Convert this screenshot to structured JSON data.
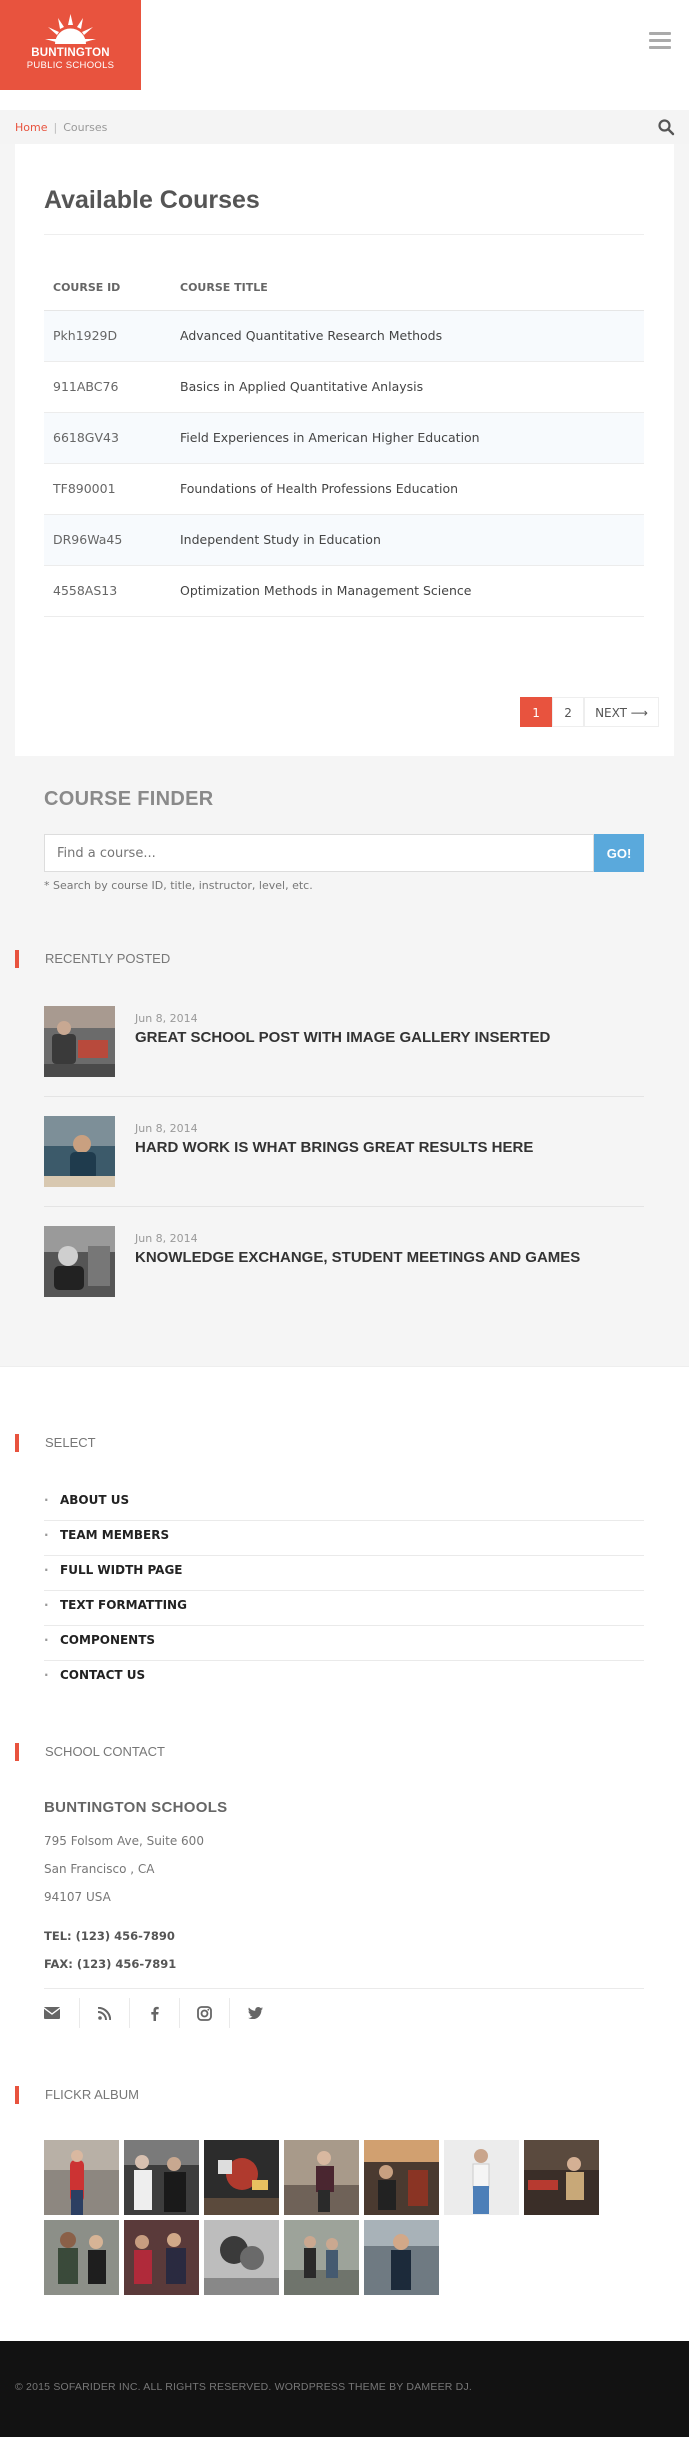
{
  "brand": {
    "line1": "BUNTINGTON",
    "line2": "PUBLIC SCHOOLS",
    "color": "#e8533e"
  },
  "breadcrumb": {
    "home": "Home",
    "separator": "|",
    "current": "Courses"
  },
  "courses": {
    "title": "Available Courses",
    "headers": [
      "COURSE ID",
      "COURSE TITLE"
    ],
    "rows": [
      {
        "id": "Pkh1929D",
        "title": "Advanced Quantitative Research Methods"
      },
      {
        "id": "911ABC76",
        "title": "Basics in Applied Quantitative Anlaysis"
      },
      {
        "id": "6618GV43",
        "title": "Field Experiences in American Higher Education"
      },
      {
        "id": "TF890001",
        "title": "Foundations of Health Professions Education"
      },
      {
        "id": "DR96Wa45",
        "title": "Independent Study in Education"
      },
      {
        "id": "4558AS13",
        "title": "Optimization Methods in Management Science"
      }
    ]
  },
  "pagination": {
    "pages": [
      "1",
      "2"
    ],
    "current": "1",
    "next": "NEXT ⟶"
  },
  "finder": {
    "title": "COURSE FINDER",
    "placeholder": "Find a course...",
    "button": "GO!",
    "hint": "* Search by course ID, title, instructor, level, etc."
  },
  "recent": {
    "heading": "RECENTLY POSTED",
    "posts": [
      {
        "date": "Jun 8, 2014",
        "title": "GREAT SCHOOL POST WITH IMAGE GALLERY INSERTED"
      },
      {
        "date": "Jun 8, 2014",
        "title": "HARD WORK IS WHAT BRINGS GREAT RESULTS HERE"
      },
      {
        "date": "Jun 8, 2014",
        "title": "KNOWLEDGE EXCHANGE, STUDENT MEETINGS AND GAMES"
      }
    ]
  },
  "select": {
    "heading": "SELECT",
    "items": [
      "ABOUT US",
      "TEAM MEMBERS",
      "FULL WIDTH PAGE",
      "TEXT FORMATTING",
      "COMPONENTS",
      "CONTACT US"
    ]
  },
  "contact": {
    "heading": "SCHOOL CONTACT",
    "name": "BUNTINGTON SCHOOLS",
    "address1": "795 Folsom Ave, Suite 600",
    "address2": "San Francisco , CA",
    "address3": "94107 USA",
    "tel": "TEL: (123) 456-7890",
    "fax": "FAX: (123) 456-7891",
    "social_icons": [
      "mail-icon",
      "rss-icon",
      "facebook-icon",
      "instagram-icon",
      "twitter-icon"
    ]
  },
  "flickr": {
    "heading": "FLICKR ALBUM",
    "photo_count": 12
  },
  "footer": {
    "copyright": "© 2015 SOFARIDER INC. ALL RIGHTS RESERVED. WORDPRESS THEME BY DAMEER DJ."
  },
  "colors": {
    "accent": "#e8533e",
    "go_button": "#5aa9dc",
    "footer_bg": "#121212",
    "panel_bg": "#f5f5f5"
  }
}
